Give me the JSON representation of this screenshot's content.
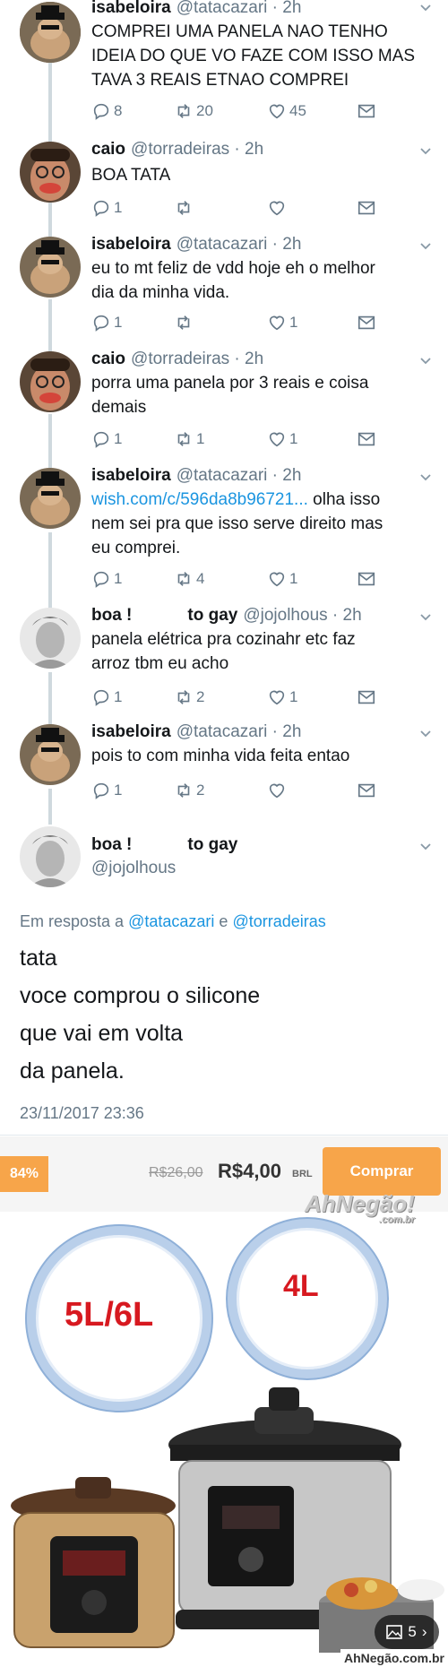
{
  "tweets": [
    {
      "name": "isabeloira",
      "handle": "@tatacazari · 2h",
      "lines": [
        "COMPREI UMA PANELA NAO TENHO",
        "IDEIA DO QUE VO FAZE COM ISSO MAS",
        "TAVA 3 REAIS ETNAO COMPREI"
      ],
      "reply": "8",
      "retweet": "20",
      "like": "45"
    },
    {
      "name": "caio",
      "handle": "@torradeiras · 2h",
      "lines": [
        "BOA TATA"
      ],
      "reply": "1",
      "retweet": "",
      "like": ""
    },
    {
      "name": "isabeloira",
      "handle": "@tatacazari · 2h",
      "lines": [
        "eu to mt feliz de vdd hoje eh o melhor",
        "dia da minha vida."
      ],
      "reply": "1",
      "retweet": "",
      "like": "1"
    },
    {
      "name": "caio",
      "handle": "@torradeiras · 2h",
      "lines": [
        "porra uma panela por 3 reais e coisa",
        "demais"
      ],
      "reply": "1",
      "retweet": "1",
      "like": "1"
    },
    {
      "name": "isabeloira",
      "handle": "@tatacazari · 2h",
      "link": "wish.com/c/596da8b96721...",
      "lines": [
        " olha isso",
        "nem sei pra que isso serve direito mas",
        "eu comprei."
      ],
      "reply": "1",
      "retweet": "4",
      "like": "1"
    },
    {
      "name": "boa !",
      "name2": "to gay",
      "handle": "@jojolhous · 2h",
      "lines": [
        "panela elétrica pra cozinahr etc faz",
        "arroz tbm eu acho"
      ],
      "reply": "1",
      "retweet": "2",
      "like": "1"
    },
    {
      "name": "isabeloira",
      "handle": "@tatacazari · 2h",
      "lines": [
        "pois to com minha vida feita entao"
      ],
      "reply": "1",
      "retweet": "2",
      "like": ""
    }
  ],
  "main_tweet": {
    "name": "boa !",
    "name2": "to gay",
    "handle": "@jojolhous",
    "reply_prefix": "Em resposta a",
    "mention1": "@tatacazari",
    "conj": "e",
    "mention2": "@torradeiras",
    "lines": [
      "tata",
      "voce comprou o silicone",
      "que vai em volta",
      "da panela."
    ],
    "date": "23/11/2017 23:36"
  },
  "product": {
    "discount": "84%",
    "old_price": "R$26,00",
    "new_price": "R$4,00",
    "currency": "BRL",
    "buy_label": "Comprar",
    "watermark": "AhNegão!",
    "watermark_sub": ".com.br",
    "size_left": "5L/6L",
    "size_right": "4L",
    "gallery_count": "5",
    "gallery_arrow": "›",
    "site": "AhNegão.com.br"
  },
  "colors": {
    "link": "#1b95e0",
    "muted": "#657786",
    "accent": "#f7a54a",
    "size_text": "#d71920"
  },
  "icons": [
    "reply-icon",
    "retweet-icon",
    "heart-icon",
    "mail-icon",
    "chevron-down-icon",
    "gallery-icon"
  ]
}
